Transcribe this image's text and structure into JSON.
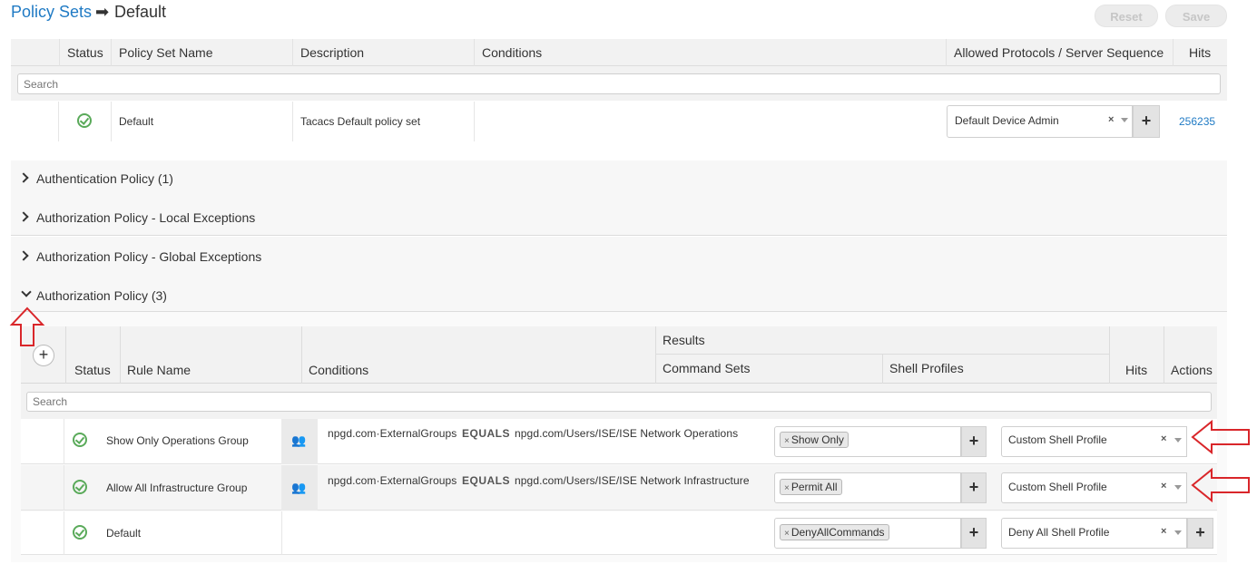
{
  "breadcrumb": {
    "link": "Policy Sets",
    "separator": "➡",
    "current": "Default"
  },
  "buttons": {
    "reset": "Reset",
    "save": "Save"
  },
  "policy_sets_table": {
    "headers": [
      "Status",
      "Policy Set Name",
      "Description",
      "Conditions",
      "Allowed Protocols / Server Sequence",
      "Hits"
    ],
    "search_placeholder": "Search",
    "row": {
      "name": "Default",
      "description": "Tacacs Default policy set",
      "protocol": "Default Device Admin",
      "hits": "256235"
    }
  },
  "sections": {
    "authentication": "Authentication Policy (1)",
    "local_exceptions": "Authorization Policy - Local Exceptions",
    "global_exceptions": "Authorization Policy - Global Exceptions",
    "authorization": "Authorization Policy (3)"
  },
  "auth_table": {
    "headers": {
      "status": "Status",
      "rule_name": "Rule Name",
      "conditions": "Conditions",
      "results": "Results",
      "command_sets": "Command Sets",
      "shell_profiles": "Shell Profiles",
      "hits": "Hits",
      "actions": "Actions"
    },
    "search_placeholder": "Search",
    "rows": [
      {
        "name": "Show Only Operations Group",
        "cond_attr": "npgd.com·ExternalGroups",
        "cond_op": "EQUALS",
        "cond_value": "npgd.com/Users/ISE/ISE Network Operations",
        "command_set": "Show Only",
        "shell_profile": "Custom Shell Profile"
      },
      {
        "name": "Allow All Infrastructure Group",
        "cond_attr": "npgd.com·ExternalGroups",
        "cond_op": "EQUALS",
        "cond_value": "npgd.com/Users/ISE/ISE Network Infrastructure",
        "command_set": "Permit All",
        "shell_profile": "Custom Shell Profile"
      },
      {
        "name": "Default",
        "command_set": "DenyAllCommands",
        "shell_profile": "Deny All Shell Profile"
      }
    ]
  },
  "icons": {
    "status": "check-circle-icon",
    "group": "user-group-icon",
    "remove": "×",
    "add": "+"
  },
  "colors": {
    "link": "#1f7ac4",
    "status_ok": "#5aaa5a",
    "annotation": "#d9262a"
  }
}
